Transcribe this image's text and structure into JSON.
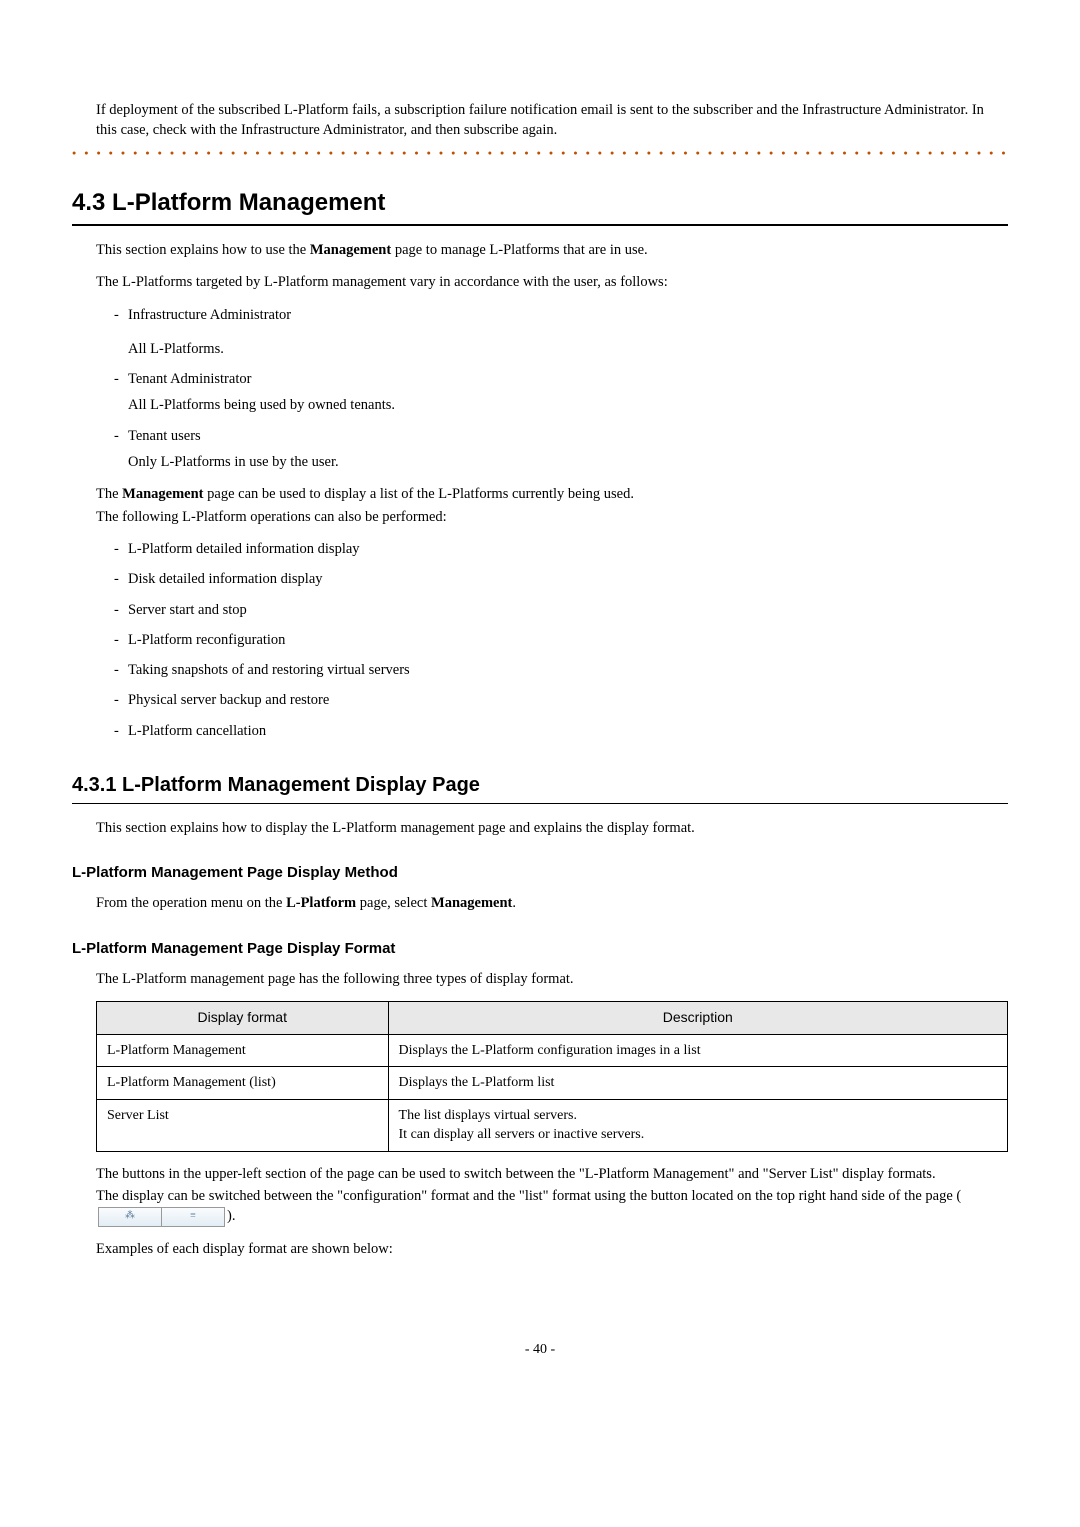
{
  "note": {
    "text": "If deployment of the subscribed L-Platform fails, a subscription failure notification email is sent to the subscriber and the Infrastructure Administrator. In this case, check with the Infrastructure Administrator, and then subscribe again."
  },
  "section43": {
    "number": "4.3",
    "title": "L-Platform Management",
    "intro_prefix": "This section explains how to use the ",
    "intro_bold": "Management",
    "intro_suffix": " page to manage L-Platforms that are in use.",
    "targets_intro": "The L-Platforms targeted by L-Platform management vary in accordance with the user, as follows:",
    "targets": [
      {
        "role": "Infrastructure Administrator",
        "detail": "All L-Platforms."
      },
      {
        "role": "Tenant Administrator",
        "detail": "All L-Platforms being used by owned tenants."
      },
      {
        "role": "Tenant users",
        "detail": "Only L-Platforms in use by the user."
      }
    ],
    "mgmt_para_prefix": "The ",
    "mgmt_para_bold": "Management",
    "mgmt_para_mid": " page can be used to display a list of the L-Platforms currently being used.",
    "mgmt_para_line2": "The following L-Platform operations can also be performed:",
    "ops": [
      "L-Platform detailed information display",
      "Disk detailed information display",
      "Server start and stop",
      "L-Platform reconfiguration",
      "Taking snapshots of and restoring virtual servers",
      "Physical server backup and restore",
      "L-Platform cancellation"
    ]
  },
  "section431": {
    "number": "4.3.1",
    "title": "L-Platform Management Display Page",
    "intro": "This section explains how to display the L-Platform management page and explains the display format.",
    "method": {
      "heading": "L-Platform Management Page Display Method",
      "text_prefix": "From the operation menu on the ",
      "text_bold1": "L-Platform",
      "text_mid": " page, select ",
      "text_bold2": "Management",
      "text_suffix": "."
    },
    "format": {
      "heading": "L-Platform Management Page Display Format",
      "intro": "The L-Platform management page has the following three types of display format.",
      "table": {
        "head": {
          "c1": "Display format",
          "c2": "Description"
        },
        "rows": [
          {
            "c1": "L-Platform Management",
            "c2": "Displays the L-Platform configuration images in a list"
          },
          {
            "c1": "L-Platform Management (list)",
            "c2": "Displays the L-Platform list"
          },
          {
            "c1": "Server List",
            "c2a": "The list displays virtual servers.",
            "c2b": "It can display all servers or inactive servers."
          }
        ]
      },
      "after1": "The buttons in the upper-left section of the page can be used to switch between the \"L-Platform Management\" and \"Server List\" display formats.",
      "after2_prefix": "The display can be switched between the \"configuration\" format and the \"list\" format using the button located on the top right hand side of the page (",
      "after2_suffix": ").",
      "after3": "Examples of each display format are shown below:"
    }
  },
  "toggle": {
    "left_icon": "⁂",
    "right_icon": "≡"
  },
  "page_number": "- 40 -"
}
